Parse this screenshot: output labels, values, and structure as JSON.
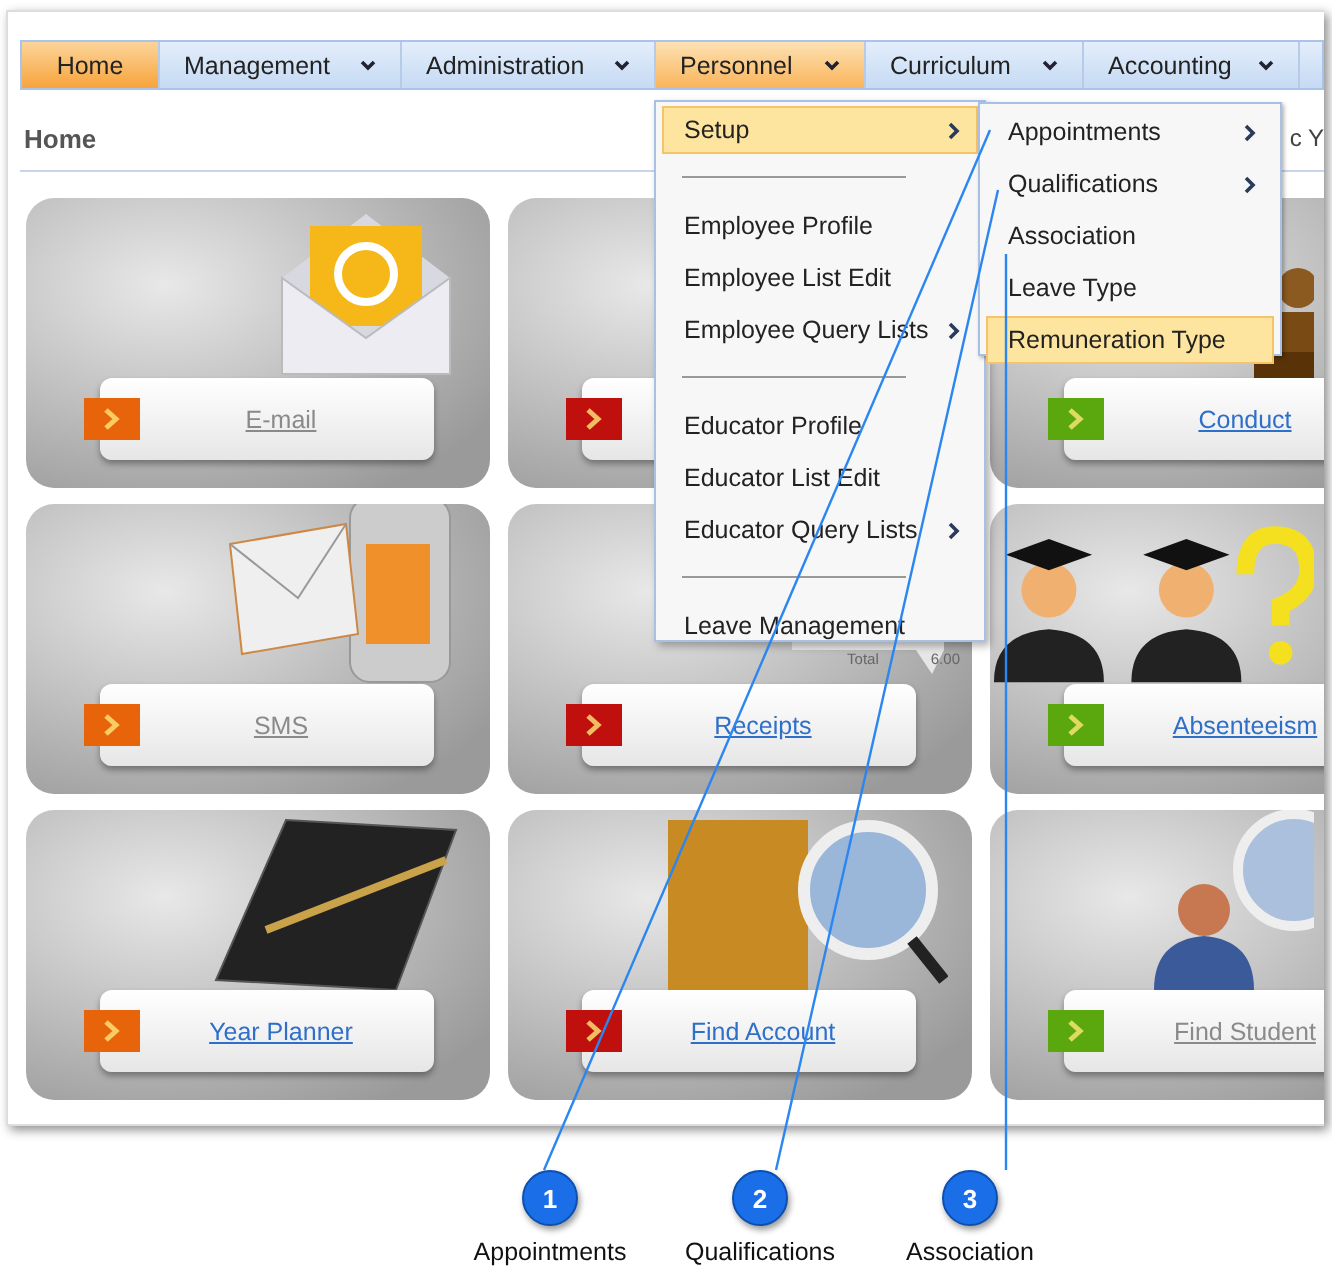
{
  "nav": [
    {
      "label": "Home",
      "kind": "plain",
      "selected": true,
      "expanded": false
    },
    {
      "label": "Management",
      "kind": "dropdown",
      "selected": false,
      "expanded": false
    },
    {
      "label": "Administration",
      "kind": "dropdown",
      "selected": false,
      "expanded": false
    },
    {
      "label": "Personnel",
      "kind": "dropdown",
      "selected": false,
      "expanded": true
    },
    {
      "label": "Curriculum",
      "kind": "dropdown",
      "selected": false,
      "expanded": false
    },
    {
      "label": "Accounting",
      "kind": "dropdown",
      "selected": false,
      "expanded": false
    }
  ],
  "page_title": "Home",
  "header_fragment": "c Y",
  "menu": [
    {
      "kind": "item",
      "label": "Setup",
      "submenu": true,
      "highlighted": true
    },
    {
      "kind": "separator"
    },
    {
      "kind": "item",
      "label": "Employee Profile",
      "submenu": false,
      "highlighted": false
    },
    {
      "kind": "item",
      "label": "Employee List Edit",
      "submenu": false,
      "highlighted": false
    },
    {
      "kind": "item",
      "label": "Employee Query Lists",
      "submenu": true,
      "highlighted": false
    },
    {
      "kind": "separator"
    },
    {
      "kind": "item",
      "label": "Educator Profile",
      "submenu": false,
      "highlighted": false
    },
    {
      "kind": "item",
      "label": "Educator List Edit",
      "submenu": false,
      "highlighted": false
    },
    {
      "kind": "item",
      "label": "Educator Query Lists",
      "submenu": true,
      "highlighted": false
    },
    {
      "kind": "separator"
    },
    {
      "kind": "item",
      "label": "Leave Management",
      "submenu": false,
      "highlighted": false
    }
  ],
  "submenu": [
    {
      "kind": "item",
      "label": "Appointments",
      "submenu": true,
      "highlighted": false
    },
    {
      "kind": "item",
      "label": "Qualifications",
      "submenu": true,
      "highlighted": false
    },
    {
      "kind": "item",
      "label": "Association",
      "submenu": false,
      "highlighted": false
    },
    {
      "kind": "item",
      "label": "Leave Type",
      "submenu": false,
      "highlighted": false
    },
    {
      "kind": "item",
      "label": "Remuneration Type",
      "submenu": false,
      "highlighted": true
    }
  ],
  "tiles": [
    {
      "label": "E-mail",
      "visited": true,
      "color": "#e8640a"
    },
    {
      "color": "#c0100e"
    },
    {
      "label": "Conduct",
      "visited": false,
      "color": "#5aa80e"
    },
    {
      "label": "SMS",
      "visited": true,
      "color": "#e8640a"
    },
    {
      "label": "Receipts",
      "visited": false,
      "color": "#c0100e"
    },
    {
      "label": "Absenteeism",
      "visited": false,
      "color": "#5aa80e"
    },
    {
      "label": "Year Planner",
      "visited": false,
      "color": "#e8640a"
    },
    {
      "label": "Find Account",
      "visited": false,
      "color": "#c0100e"
    },
    {
      "label": "Find Student",
      "visited": true,
      "color": "#5aa80e"
    }
  ],
  "receipt_texts": [
    "Total",
    "6.00"
  ],
  "callouts": [
    {
      "number": "1",
      "label": "Appointments"
    },
    {
      "number": "2",
      "label": "Qualifications"
    },
    {
      "number": "3",
      "label": "Association"
    }
  ]
}
